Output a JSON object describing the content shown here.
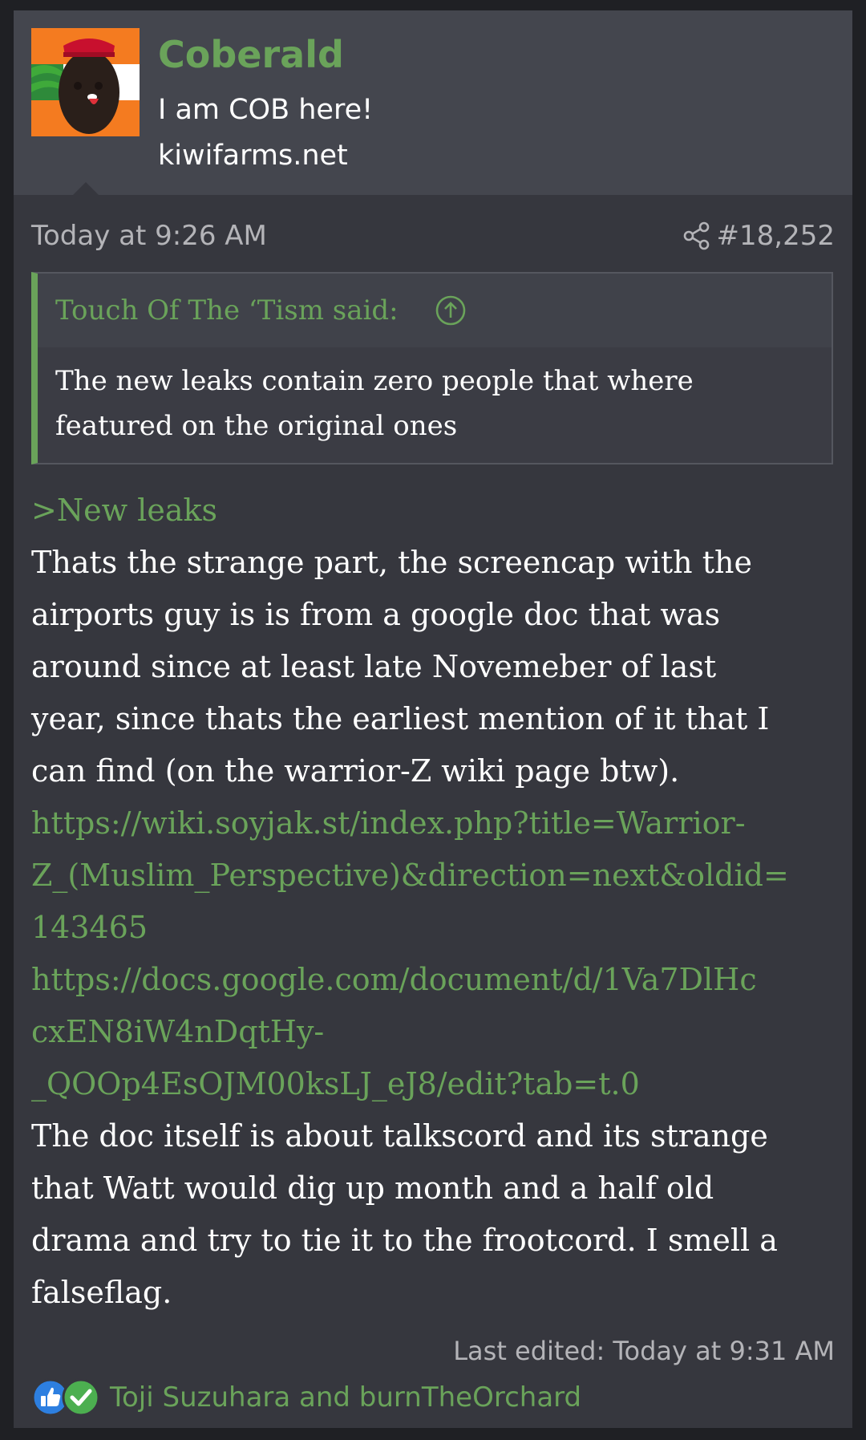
{
  "user": {
    "name": "Coberald",
    "title": "I am COB here!",
    "site": "kiwifarms.net",
    "avatar_icon": "avatar-image"
  },
  "post": {
    "date": "Today at 9:26 AM",
    "number": "#18,252",
    "share_icon": "share-icon"
  },
  "quote": {
    "attribution": "Touch Of The ‘Tism said:",
    "up_icon": "arrow-up-circle-icon",
    "lines": [
      "The new leaks contain zero people that where",
      "featured on the original ones"
    ]
  },
  "body": {
    "lines": [
      ">New leaks",
      "Thats the strange part, the screencap with the",
      "airports guy is is from a google doc that was",
      "around since at least late Novemeber of last",
      "year, since thats the earliest mention of it that I",
      "can find (on the warrior-Z wiki page btw).",
      "https://wiki.soyjak.st/index.php?title=Warrior-",
      "Z_(Muslim_Perspective)&direction=next&oldid=",
      "143465",
      "https://docs.google.com/document/d/1Va7DlHc",
      "cxEN8iW4nDqtHy-",
      "_QOOp4EsOJM00ksLJ_eJ8/edit?tab=t.0",
      "The doc itself is about talkscord and its strange",
      "that Watt would dig up month and a half old",
      "drama and try to tie it to the frootcord. I smell a",
      "falseflag."
    ]
  },
  "edited": "Last edited: Today at 9:31 AM",
  "reactions": {
    "icons": [
      "like-icon",
      "check-icon"
    ],
    "users": "Toji Suzuhara and burnTheOrchard"
  },
  "colors": {
    "accent": "#6aa35a",
    "background": "#36373e",
    "header": "#44464e",
    "text": "#ffffff",
    "muted": "#b4b4b8"
  }
}
